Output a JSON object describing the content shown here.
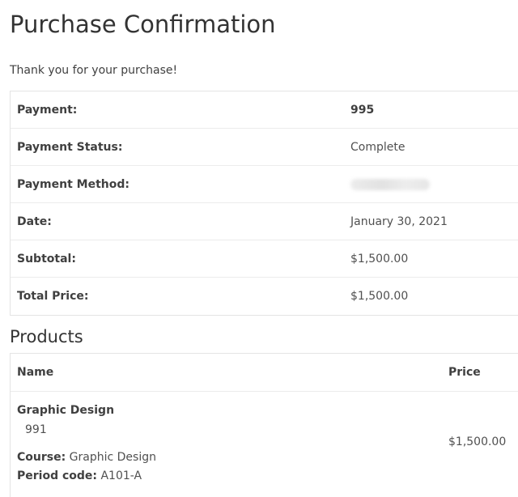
{
  "page": {
    "title": "Purchase Confirmation",
    "thanks_message": "Thank you for your purchase!"
  },
  "receipt": {
    "rows": [
      {
        "label": "Payment:",
        "value": "995"
      },
      {
        "label": "Payment Status:",
        "value": "Complete"
      },
      {
        "label": "Payment Method:",
        "value": ""
      },
      {
        "label": "Date:",
        "value": "January 30, 2021"
      },
      {
        "label": "Subtotal:",
        "value": "$1,500.00"
      },
      {
        "label": "Total Price:",
        "value": "$1,500.00"
      }
    ]
  },
  "products": {
    "section_title": "Products",
    "headers": {
      "name": "Name",
      "price": "Price"
    },
    "items": [
      {
        "name": "Graphic Design",
        "id": "991",
        "course_label": "Course:",
        "course_value": "Graphic Design",
        "period_label": "Period code:",
        "period_value": "A101-A",
        "price": "$1,500.00"
      }
    ]
  }
}
